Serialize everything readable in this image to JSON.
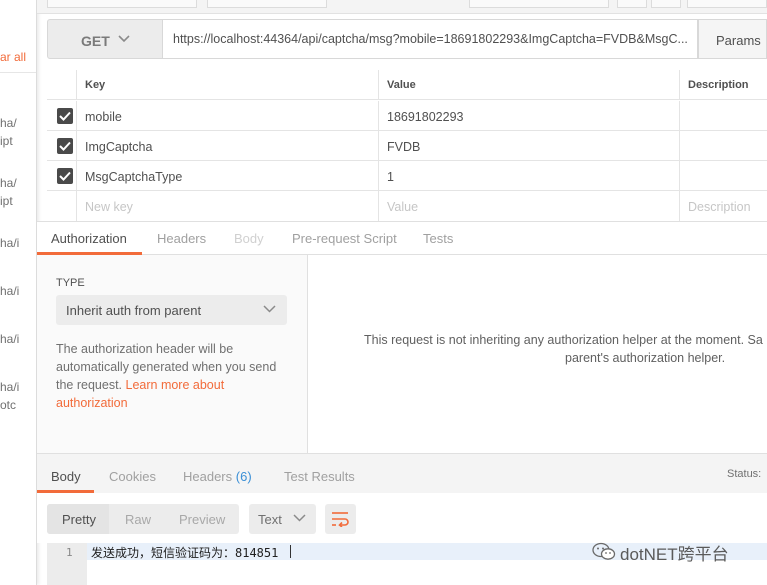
{
  "sidebar": {
    "clear_all": "ar all",
    "fragments": [
      "ha/",
      "ipt",
      "ha/",
      "ipt",
      "ha/i",
      "ha/i",
      "ha/i",
      "ha/i",
      "otc"
    ]
  },
  "request": {
    "method": "GET",
    "url": "https://localhost:44364/api/captcha/msg?mobile=18691802293&ImgCaptcha=FVDB&MsgC...",
    "params_button": "Params"
  },
  "params_table": {
    "headers": [
      "Key",
      "Value",
      "Description"
    ],
    "rows": [
      {
        "key": "mobile",
        "value": "18691802293",
        "checked": true
      },
      {
        "key": "ImgCaptcha",
        "value": "FVDB",
        "checked": true
      },
      {
        "key": "MsgCaptchaType",
        "value": "1",
        "checked": true
      }
    ],
    "placeholder": {
      "key": "New key",
      "value": "Value",
      "description": "Description"
    }
  },
  "request_tabs": {
    "items": [
      "Authorization",
      "Headers",
      "Body",
      "Pre-request Script",
      "Tests"
    ],
    "active": "Authorization"
  },
  "auth": {
    "type_label": "TYPE",
    "type_value": "Inherit auth from parent",
    "description": "The authorization header will be automatically generated when you send the request. ",
    "learn_more": "Learn more about authorization",
    "message_line1": "This request is not inheriting any authorization helper at the moment. Sa",
    "message_line2": "parent's authorization helper."
  },
  "response": {
    "tabs": [
      "Body",
      "Cookies",
      "Headers",
      "Test Results"
    ],
    "headers_count": "(6)",
    "status_label": "Status:",
    "format_buttons": [
      "Pretty",
      "Raw",
      "Preview"
    ],
    "language": "Text",
    "line_number": "1",
    "body_line": "发送成功，短信验证码为：814851"
  },
  "watermark": {
    "text": "dotNET跨平台"
  },
  "colors": {
    "accent": "#f26b3a",
    "link_blue": "#3a8fd6"
  }
}
